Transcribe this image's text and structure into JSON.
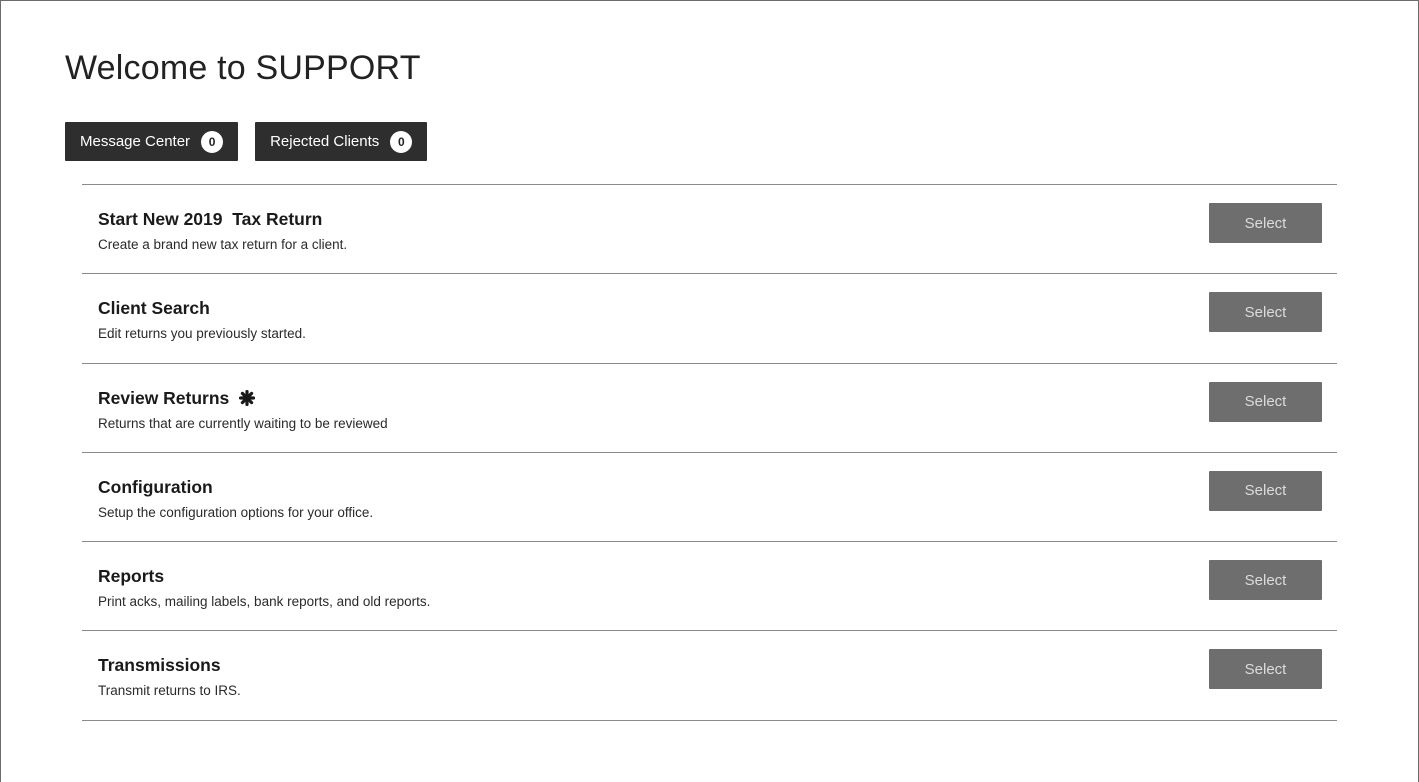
{
  "page": {
    "title": "Welcome to SUPPORT"
  },
  "top_buttons": [
    {
      "label": "Message Center",
      "count": "0"
    },
    {
      "label": "Rejected Clients",
      "count": "0"
    }
  ],
  "menu": [
    {
      "title": "Start New 2019  Tax Return",
      "description": "Create a brand new tax return for a client.",
      "button": "Select",
      "has_icon": false
    },
    {
      "title": "Client Search",
      "description": "Edit returns you previously started.",
      "button": "Select",
      "has_icon": false
    },
    {
      "title": "Review Returns",
      "description": "Returns that are currently waiting to be reviewed",
      "button": "Select",
      "has_icon": true,
      "icon": "asterisk-icon"
    },
    {
      "title": "Configuration",
      "description": "Setup the configuration options for your office.",
      "button": "Select",
      "has_icon": false
    },
    {
      "title": "Reports",
      "description": "Print acks, mailing labels, bank reports, and old reports.",
      "button": "Select",
      "has_icon": false
    },
    {
      "title": "Transmissions",
      "description": "Transmit returns to IRS.",
      "button": "Select",
      "has_icon": false
    }
  ],
  "colors": {
    "dark_button": "#2e2e2e",
    "select_button": "#6e6e6e",
    "divider": "#8a8a8a"
  }
}
